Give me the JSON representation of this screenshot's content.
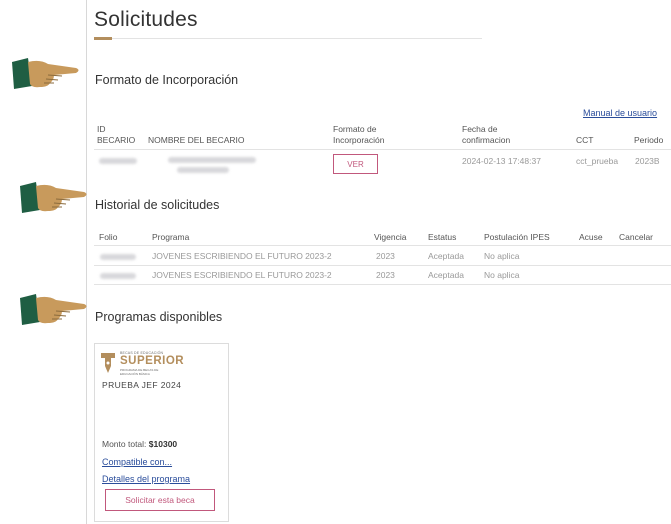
{
  "page": {
    "title": "Solicitudes"
  },
  "formato": {
    "section_title": "Formato de Incorporación",
    "manual_link": "Manual de usuario",
    "headers": {
      "id_line1": "ID",
      "id_line2": "BECARIO",
      "nombre": "NOMBRE DEL BECARIO",
      "formato_line1": "Formato de",
      "formato_line2": "Incorporación",
      "fecha_line1": "Fecha de",
      "fecha_line2": "confirmacion",
      "cct": "CCT",
      "periodo": "Periodo"
    },
    "row": {
      "ver_label": "VER",
      "fecha": "2024-02-13 17:48:37",
      "cct": "cct_prueba",
      "periodo": "2023B"
    }
  },
  "historial": {
    "section_title": "Historial de solicitudes",
    "headers": {
      "folio": "Folio",
      "programa": "Programa",
      "vigencia": "Vigencia",
      "estatus": "Estatus",
      "postulacion": "Postulación IPES",
      "acuse": "Acuse",
      "cancelar": "Cancelar"
    },
    "rows": [
      {
        "programa": "JOVENES ESCRIBIENDO EL FUTURO 2023-2",
        "vigencia": "2023",
        "estatus": "Aceptada",
        "postulacion": "No aplica"
      },
      {
        "programa": "JOVENES ESCRIBIENDO EL FUTURO 2023-2",
        "vigencia": "2023",
        "estatus": "Aceptada",
        "postulacion": "No aplica"
      }
    ]
  },
  "programas": {
    "section_title": "Programas disponibles",
    "card": {
      "logo_small": "BECAS DE EDUCACIÓN",
      "logo_big": "SUPERIOR",
      "logo_sub": "PROGRAMA DE BECAS DE EDUCACIÓN BÁSICA",
      "name": "PRUEBA JEF 2024",
      "monto_label": "Monto total:",
      "monto_value": "$10300",
      "compatible_link": "Compatible con...",
      "detalles_link": "Detalles del programa",
      "solicitar_label": "Solicitar esta beca"
    }
  },
  "colors": {
    "accent": "#b38e5d",
    "brand_pink": "#c1587c",
    "link": "#2a4d9b",
    "hand_skin": "#c89a5c",
    "sleeve": "#1f5e43"
  }
}
